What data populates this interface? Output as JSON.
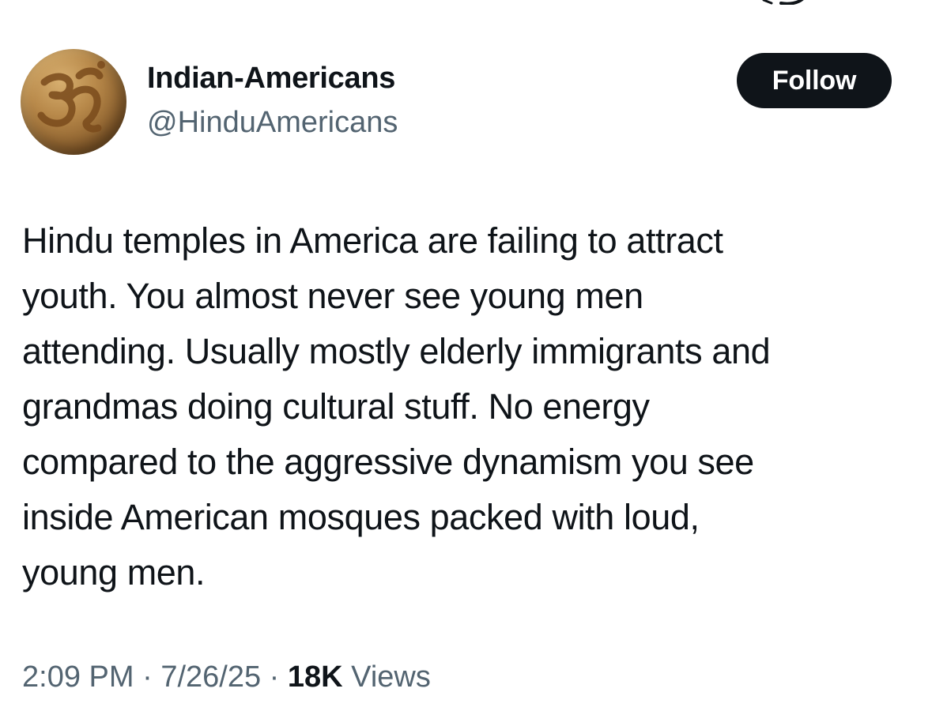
{
  "profile": {
    "avatar_icon": "om-symbol-icon",
    "name": "Indian-Americans",
    "handle": "@HinduAmericans"
  },
  "actions": {
    "follow_label": "Follow"
  },
  "tweet": {
    "lines": [
      "Hindu temples in America are failing to attract",
      "youth. You almost never see young men",
      "attending. Usually mostly elderly immigrants and",
      "grandmas doing cultural stuff. No energy",
      "compared to the aggressive dynamism you see",
      "inside American mosques packed with loud,",
      "young men."
    ]
  },
  "meta": {
    "time": "2:09 PM",
    "separator": "·",
    "date": "7/26/25",
    "views_count": "18K",
    "views_label": "Views"
  },
  "colors": {
    "text_primary": "#0f1419",
    "text_secondary": "#536471",
    "follow_bg": "#0f1419",
    "follow_text": "#ffffff"
  }
}
